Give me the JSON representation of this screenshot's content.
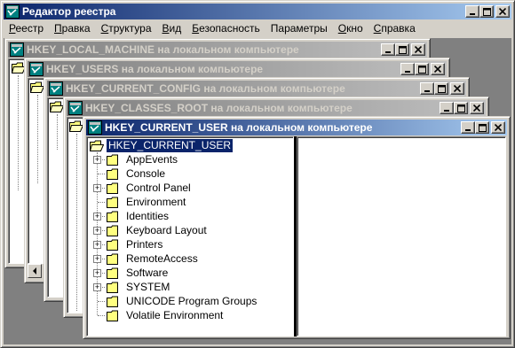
{
  "app": {
    "title": "Редактор реестра"
  },
  "menu": [
    {
      "label": "Реестр",
      "u": "Р",
      "rest": "еестр"
    },
    {
      "label": "Правка",
      "u": "П",
      "rest": "равка"
    },
    {
      "label": "Структура",
      "u": "С",
      "rest": "труктура"
    },
    {
      "label": "Вид",
      "u": "В",
      "rest": "ид"
    },
    {
      "label": "Безопасность",
      "u": "Б",
      "rest": "езопасность"
    },
    {
      "label": "Параметры",
      "u": "",
      "rest": "Параметры"
    },
    {
      "label": "Окно",
      "u": "О",
      "rest": "кно"
    },
    {
      "label": "Справка",
      "u": "С",
      "rest": "правка"
    }
  ],
  "windows": [
    {
      "title": "HKEY_LOCAL_MACHINE на локальном компьютере"
    },
    {
      "title": "HKEY_USERS на локальном компьютере"
    },
    {
      "title": "HKEY_CURRENT_CONFIG на локальном компьютере"
    },
    {
      "title": "HKEY_CLASSES_ROOT на локальном компьютере"
    },
    {
      "title": "HKEY_CURRENT_USER на локальном компьютере"
    }
  ],
  "tree": {
    "root": "HKEY_CURRENT_USER",
    "items": [
      {
        "label": "AppEvents",
        "expandable": true
      },
      {
        "label": "Console",
        "expandable": false
      },
      {
        "label": "Control Panel",
        "expandable": true
      },
      {
        "label": "Environment",
        "expandable": false
      },
      {
        "label": "Identities",
        "expandable": true
      },
      {
        "label": "Keyboard Layout",
        "expandable": true
      },
      {
        "label": "Printers",
        "expandable": true
      },
      {
        "label": "RemoteAccess",
        "expandable": true
      },
      {
        "label": "Software",
        "expandable": true
      },
      {
        "label": "SYSTEM",
        "expandable": true
      },
      {
        "label": "UNICODE Program Groups",
        "expandable": false
      },
      {
        "label": "Volatile Environment",
        "expandable": false
      }
    ]
  },
  "colors": {
    "active_title": "#0a246a",
    "inactive_title": "#808080",
    "face": "#d4d0c8",
    "folder": "#ffff80"
  }
}
